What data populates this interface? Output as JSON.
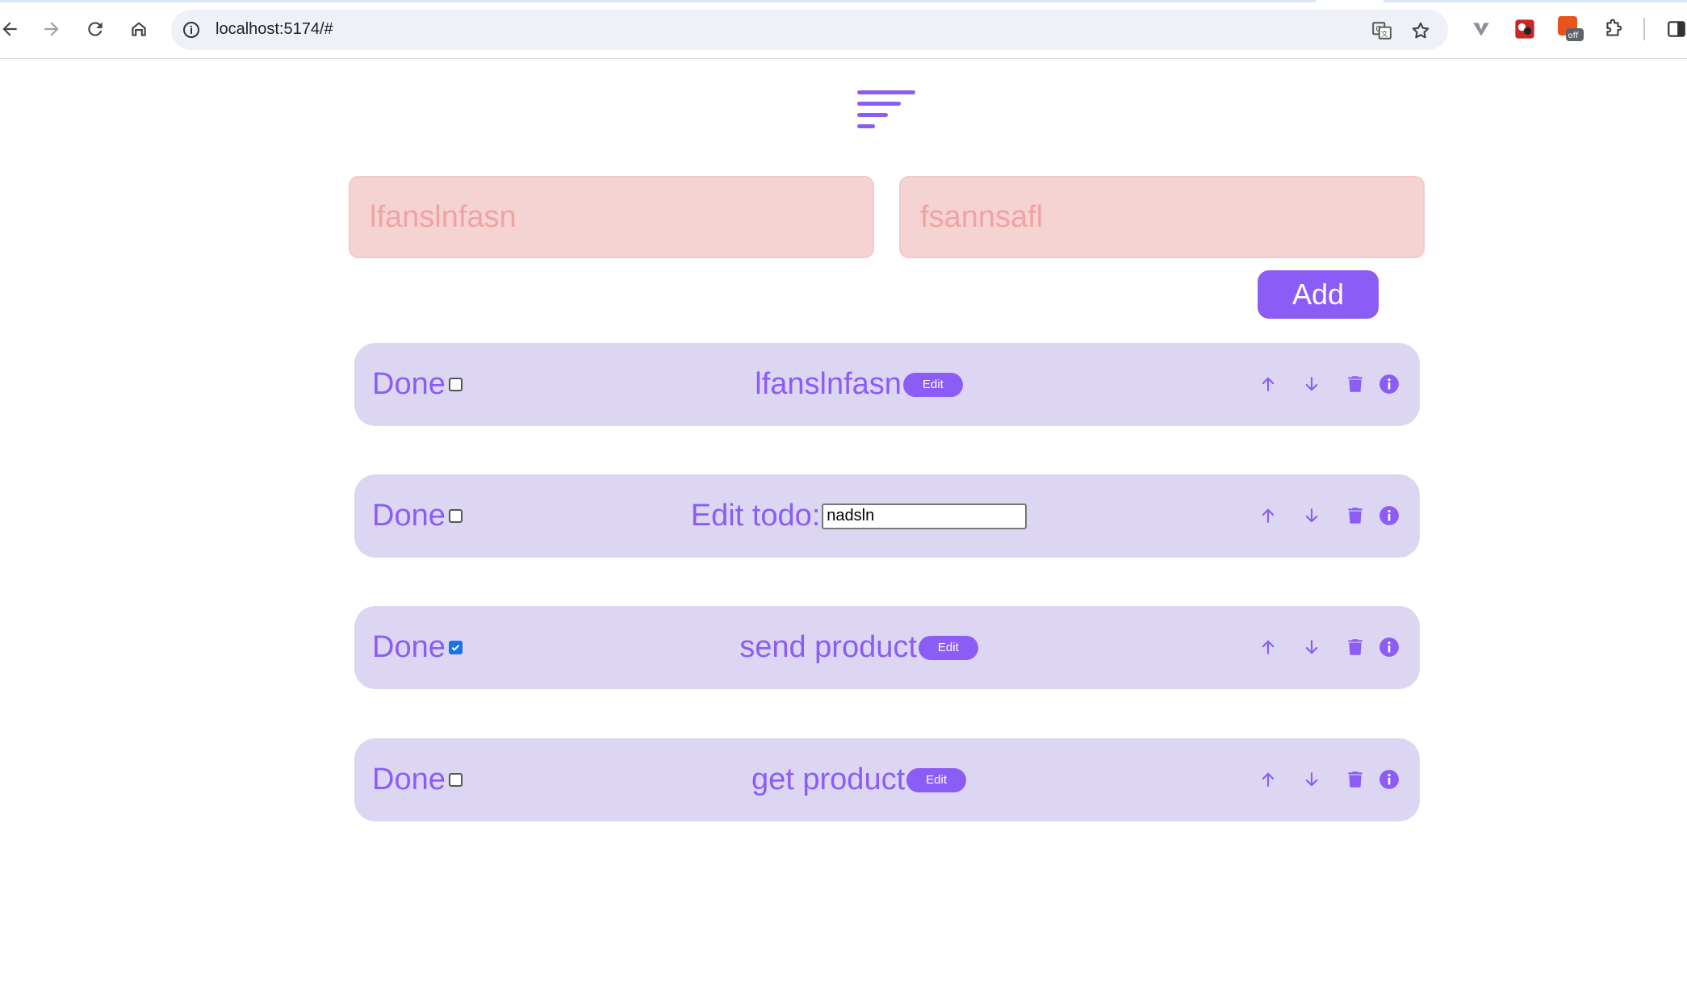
{
  "browser": {
    "url": "localhost:5174/#",
    "icons": [
      "back-icon",
      "forward-icon",
      "reload-icon",
      "home-icon",
      "info-icon",
      "translate-icon",
      "bookmark-star-icon",
      "extension-v-icon",
      "extension-red-icon",
      "extension-off-icon",
      "extensions-puzzle-icon",
      "side-panel-icon"
    ],
    "extension_badge": "off"
  },
  "app": {
    "logo_icon": "sort-lines-icon",
    "title_input": {
      "value": "lfanslnfasn"
    },
    "description_input": {
      "value": "fsannsafl"
    },
    "add_label": "Add",
    "accent_color": "#8b5cf6",
    "todos": [
      {
        "done_label": "Done",
        "checked": false,
        "mode": "view",
        "title": "lfanslnfasn",
        "edit_label": "Edit"
      },
      {
        "done_label": "Done",
        "checked": false,
        "mode": "edit",
        "edit_prompt": "Edit todo:",
        "edit_value": "nadsln"
      },
      {
        "done_label": "Done",
        "checked": true,
        "mode": "view",
        "title": "send product",
        "edit_label": "Edit"
      },
      {
        "done_label": "Done",
        "checked": false,
        "mode": "view",
        "title": "get product",
        "edit_label": "Edit"
      }
    ],
    "row_actions": [
      "arrow-up-icon",
      "arrow-down-icon",
      "trash-icon",
      "info-circle-icon"
    ]
  }
}
